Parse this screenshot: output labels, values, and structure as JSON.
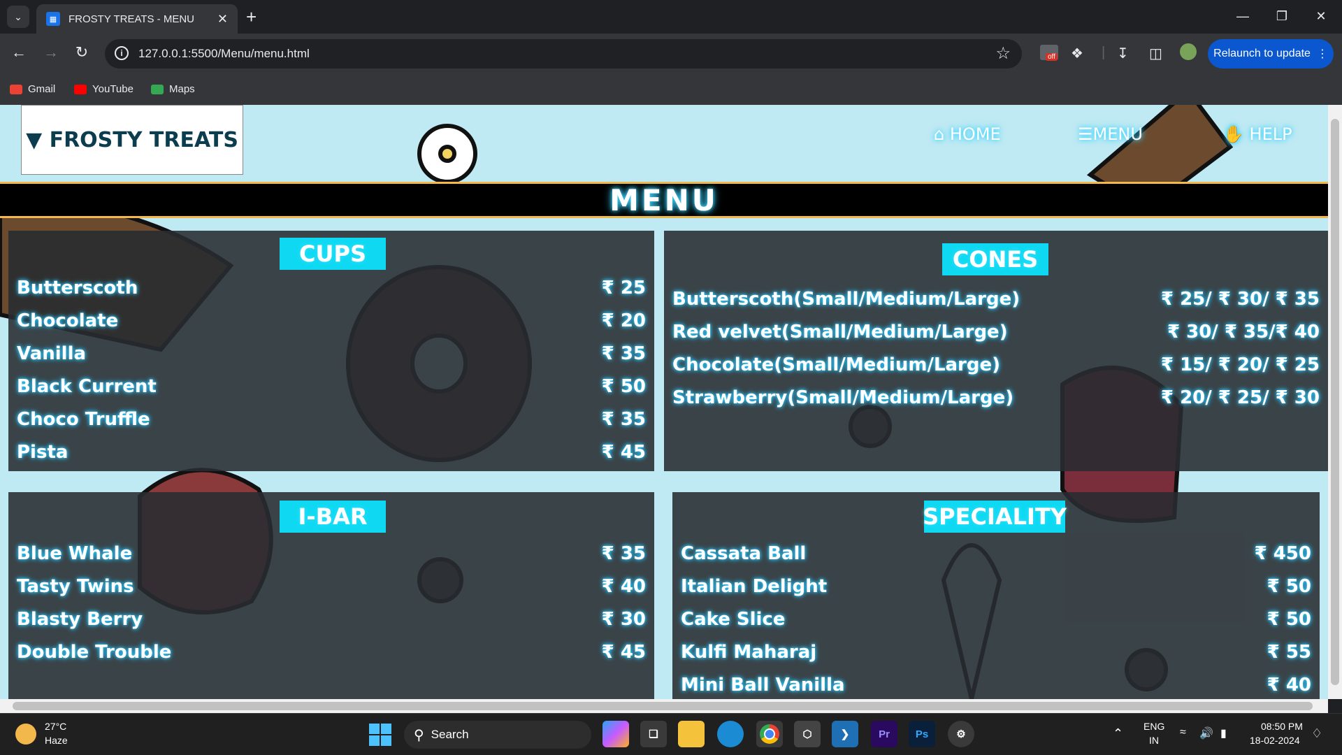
{
  "browser": {
    "tab_title": "FROSTY TREATS - MENU",
    "url": "127.0.0.1:5500/Menu/menu.html",
    "relaunch_label": "Relaunch to update",
    "ext_badge": "off",
    "bookmarks": [
      {
        "label": "Gmail",
        "color": "#ea4335"
      },
      {
        "label": "YouTube",
        "color": "#ff0000"
      },
      {
        "label": "Maps",
        "color": "#34a853"
      }
    ]
  },
  "site": {
    "logo": "FROSTY TREATS",
    "nav": {
      "home": "HOME",
      "menu": "MENU",
      "help": "HELP"
    },
    "heading": "MENU"
  },
  "sections": {
    "cups": {
      "title": "CUPS",
      "items": [
        {
          "name": "Butterscoth",
          "price": "₹ 25"
        },
        {
          "name": "Chocolate",
          "price": "₹ 20"
        },
        {
          "name": "Vanilla",
          "price": "₹ 35"
        },
        {
          "name": "Black Current",
          "price": "₹ 50"
        },
        {
          "name": "Choco Truffle",
          "price": "₹ 35"
        },
        {
          "name": "Pista",
          "price": "₹ 45"
        }
      ]
    },
    "cones": {
      "title": "CONES",
      "items": [
        {
          "name": "Butterscoth(Small/Medium/Large)",
          "price": "₹ 25/ ₹ 30/ ₹ 35"
        },
        {
          "name": "Red velvet(Small/Medium/Large)",
          "price": "₹ 30/ ₹ 35/₹ 40"
        },
        {
          "name": "Chocolate(Small/Medium/Large)",
          "price": "₹ 15/ ₹ 20/ ₹ 25"
        },
        {
          "name": "Strawberry(Small/Medium/Large)",
          "price": "₹ 20/ ₹ 25/ ₹ 30"
        }
      ]
    },
    "ibar": {
      "title": "I-BAR",
      "items": [
        {
          "name": "Blue Whale",
          "price": "₹ 35"
        },
        {
          "name": "Tasty Twins",
          "price": "₹ 40"
        },
        {
          "name": "Blasty Berry",
          "price": "₹ 30"
        },
        {
          "name": "Double Trouble",
          "price": "₹ 45"
        }
      ]
    },
    "speciality": {
      "title": "SPECIALITY",
      "items": [
        {
          "name": "Cassata Ball",
          "price": "₹ 450"
        },
        {
          "name": "Italian Delight",
          "price": "₹ 50"
        },
        {
          "name": "Cake Slice",
          "price": "₹ 50"
        },
        {
          "name": "Kulfi Maharaj",
          "price": "₹ 55"
        },
        {
          "name": "Mini Ball Vanilla",
          "price": "₹ 40"
        }
      ]
    }
  },
  "taskbar": {
    "weather_temp": "27°C",
    "weather_desc": "Haze",
    "search_label": "Search",
    "lang_top": "ENG",
    "lang_bottom": "IN",
    "time": "08:50 PM",
    "date": "18-02-2024",
    "apps": [
      {
        "label": "Pr",
        "color": "#2a0a5e"
      },
      {
        "label": "Ps",
        "color": "#0a1f3a"
      }
    ]
  }
}
